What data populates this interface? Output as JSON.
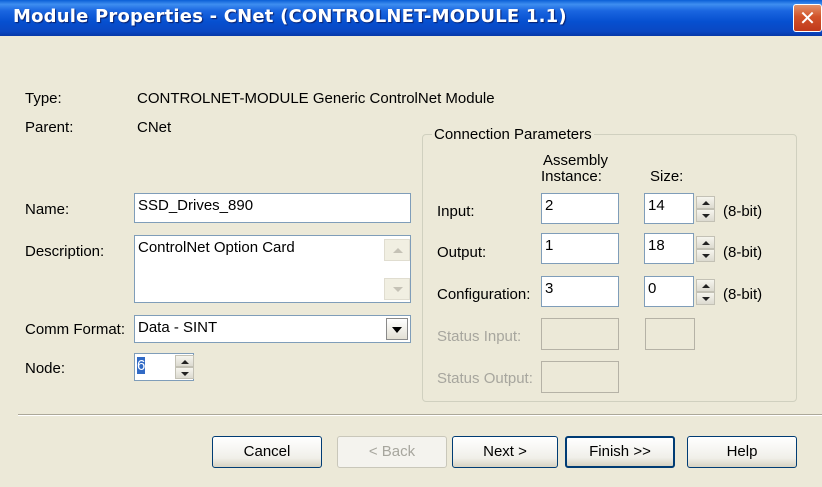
{
  "window": {
    "title": "Module Properties - CNet (CONTROLNET-MODULE 1.1)",
    "close_icon": "close-icon"
  },
  "general": {
    "type_label": "Type:",
    "type_value": "CONTROLNET-MODULE Generic ControlNet Module",
    "parent_label": "Parent:",
    "parent_value": "CNet",
    "name_label": "Name:",
    "name_value": "SSD_Drives_890",
    "description_label": "Description:",
    "description_value": "ControlNet Option Card",
    "comm_format_label": "Comm Format:",
    "comm_format_value": "Data - SINT",
    "node_label": "Node:",
    "node_value": "6"
  },
  "connection": {
    "group_title": "Connection Parameters",
    "assembly_header_line1": "Assembly",
    "assembly_header_line2": "Instance:",
    "size_header": "Size:",
    "rows": [
      {
        "label": "Input:",
        "instance": "2",
        "size": "14",
        "unit": "(8-bit)",
        "enabled": true
      },
      {
        "label": "Output:",
        "instance": "1",
        "size": "18",
        "unit": "(8-bit)",
        "enabled": true
      },
      {
        "label": "Configuration:",
        "instance": "3",
        "size": "0",
        "unit": "(8-bit)",
        "enabled": true
      },
      {
        "label": "Status Input:",
        "instance": "",
        "size": "",
        "enabled": false
      },
      {
        "label": "Status Output:",
        "instance": "",
        "enabled": false
      }
    ]
  },
  "buttons": {
    "cancel": "Cancel",
    "back": "< Back",
    "next": "Next >",
    "finish": "Finish >>",
    "help": "Help"
  },
  "colors": {
    "title_bar": "#0a47c2",
    "dialog_bg": "#ece9d8",
    "close_button": "#d2532a"
  }
}
